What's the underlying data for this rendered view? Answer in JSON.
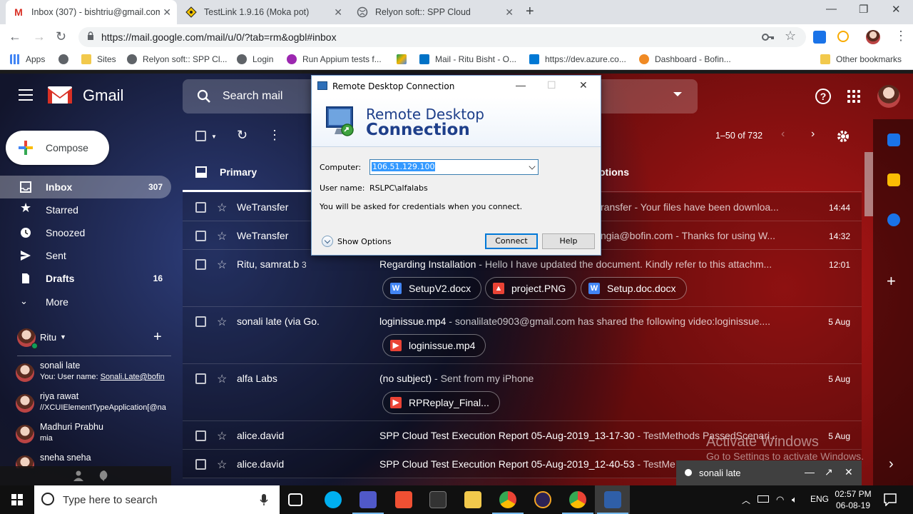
{
  "browser": {
    "tabs": [
      {
        "title": "Inbox (307) - bishtriu@gmail.com",
        "icon": "gmail-icon",
        "active": true
      },
      {
        "title": "TestLink 1.9.16 (Moka pot)",
        "icon": "testlink-icon",
        "active": false
      },
      {
        "title": "Relyon soft:: SPP Cloud",
        "icon": "globe-icon",
        "active": false
      }
    ],
    "url": "https://mail.google.com/mail/u/0/?tab=rm&ogbl#inbox",
    "bookmarks": [
      {
        "label": "Apps"
      },
      {
        "label": ""
      },
      {
        "label": "Sites"
      },
      {
        "label": "Relyon soft:: SPP Cl..."
      },
      {
        "label": "Login"
      },
      {
        "label": "Run Appium tests f..."
      },
      {
        "label": ""
      },
      {
        "label": "Mail - Ritu Bisht - O..."
      },
      {
        "label": "https://dev.azure.co..."
      },
      {
        "label": "Dashboard - Bofin..."
      }
    ],
    "other_bookmarks": "Other bookmarks"
  },
  "gmail": {
    "brand": "Gmail",
    "search_placeholder": "Search mail",
    "compose_label": "Compose",
    "nav": [
      {
        "label": "Inbox",
        "count": "307",
        "icon": "inbox-icon"
      },
      {
        "label": "Starred",
        "count": "",
        "icon": "star-icon"
      },
      {
        "label": "Snoozed",
        "count": "",
        "icon": "clock-icon"
      },
      {
        "label": "Sent",
        "count": "",
        "icon": "send-icon"
      },
      {
        "label": "Drafts",
        "count": "16",
        "icon": "draft-icon"
      },
      {
        "label": "More",
        "count": "",
        "icon": "chevron-down-icon"
      }
    ],
    "hangouts_user": "Ritu",
    "contacts": [
      {
        "name": "sonali late",
        "sub_prefix": "You: User name: ",
        "sub_link": "Sonali.Late@bofin"
      },
      {
        "name": "riya rawat",
        "sub_prefix": "//XCUIElementTypeApplication[@na",
        "sub_link": ""
      },
      {
        "name": "Madhuri Prabhu",
        "sub_prefix": "mia",
        "sub_link": ""
      },
      {
        "name": "sneha sneha",
        "sub_prefix": "",
        "sub_link": ""
      }
    ],
    "pagination": "1–50 of 732",
    "tab_primary": "Primary",
    "tab_promotions": "otions",
    "emails": [
      {
        "sender": "WeTransfer",
        "count": "",
        "subject": "",
        "snippet": "ransfer - Your files have been downloa...",
        "time": "14:44",
        "attachments": []
      },
      {
        "sender": "WeTransfer",
        "count": "",
        "subject": "",
        "snippet": "ngia@bofin.com - Thanks for using W...",
        "time": "14:32",
        "attachments": []
      },
      {
        "sender": "Ritu, samrat.b",
        "count": "3",
        "subject": "Regarding Installation",
        "snippet": " - Hello I have updated the document. Kindly refer to this attachm...",
        "time": "12:01",
        "attachments": [
          {
            "name": "SetupV2.docx",
            "kind": "word"
          },
          {
            "name": "project.PNG",
            "kind": "image"
          },
          {
            "name": "Setup.doc.docx",
            "kind": "word"
          }
        ]
      },
      {
        "sender": "sonali late (via Go.",
        "count": "",
        "subject": "loginissue.mp4",
        "snippet": " - sonalilate0903@gmail.com has shared the following video:loginissue....",
        "time": "5 Aug",
        "attachments": [
          {
            "name": "loginissue.mp4",
            "kind": "video"
          }
        ]
      },
      {
        "sender": "alfa Labs",
        "count": "",
        "subject": "(no subject)",
        "snippet": " - Sent from my iPhone",
        "time": "5 Aug",
        "attachments": [
          {
            "name": "RPReplay_Final...",
            "kind": "video"
          }
        ]
      },
      {
        "sender": "alice.david",
        "count": "",
        "subject": "SPP Cloud Test Execution Report 05-Aug-2019_13-17-30",
        "snippet": " - TestMethods PassedScenari...",
        "time": "5 Aug",
        "attachments": []
      },
      {
        "sender": "alice.david",
        "count": "",
        "subject": "SPP Cloud Test Execution Report 05-Aug-2019_12-40-53",
        "snippet": " - TestMe",
        "time": "",
        "attachments": []
      }
    ],
    "chat_popup_name": "sonali late",
    "activate_title": "Activate Windows",
    "activate_sub": "Go to Settings to activate Windows."
  },
  "rdp": {
    "window_title": "Remote Desktop Connection",
    "banner_line1": "Remote Desktop",
    "banner_line2": "Connection",
    "computer_label": "Computer:",
    "computer_value": "106.51.129.100",
    "username_label": "User name:",
    "username_value": "RSLPC\\alfalabs",
    "info_text": "You will be asked for credentials when you connect.",
    "show_options": "Show Options",
    "connect_label": "Connect",
    "help_label": "Help"
  },
  "taskbar": {
    "search_placeholder": "Type here to search",
    "language": "ENG",
    "time": "02:57 PM",
    "date": "06-08-19"
  }
}
